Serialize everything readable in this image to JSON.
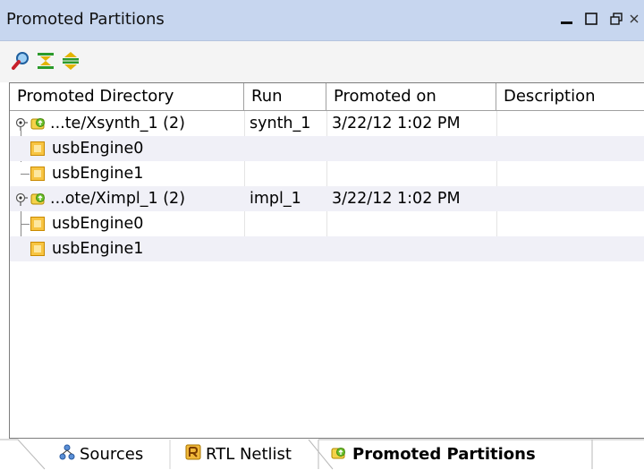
{
  "panel": {
    "title": "Promoted Partitions",
    "window_buttons": [
      "minimize-icon",
      "maximize-icon",
      "restore-icon",
      "close-icon"
    ]
  },
  "toolbar": {
    "buttons": [
      "search-icon",
      "collapse-all-icon",
      "expand-all-icon"
    ]
  },
  "table": {
    "columns": [
      "Promoted Directory",
      "Run",
      "Promoted on",
      "Description"
    ],
    "rows": [
      {
        "label": "...te/Xsynth_1 (2)",
        "run": "synth_1",
        "promoted_on": "3/22/12 1:02 PM",
        "description": "",
        "level": 0,
        "icon": "promoted-dir-icon"
      },
      {
        "label": "usbEngine0",
        "run": "",
        "promoted_on": "",
        "description": "",
        "level": 1,
        "icon": "partition-icon"
      },
      {
        "label": "usbEngine1",
        "run": "",
        "promoted_on": "",
        "description": "",
        "level": 1,
        "icon": "partition-icon"
      },
      {
        "label": "...ote/Ximpl_1 (2)",
        "run": "impl_1",
        "promoted_on": "3/22/12 1:02 PM",
        "description": "",
        "level": 0,
        "icon": "promoted-dir-icon"
      },
      {
        "label": "usbEngine0",
        "run": "",
        "promoted_on": "",
        "description": "",
        "level": 1,
        "icon": "partition-icon"
      },
      {
        "label": "usbEngine1",
        "run": "",
        "promoted_on": "",
        "description": "",
        "level": 1,
        "icon": "partition-icon"
      }
    ]
  },
  "tabs": [
    {
      "label": "Sources",
      "icon": "hierarchy-icon",
      "active": false
    },
    {
      "label": "RTL Netlist",
      "icon": "netlist-icon",
      "active": false
    },
    {
      "label": "Promoted Partitions",
      "icon": "promoted-dir-icon",
      "active": true
    }
  ],
  "colors": {
    "header_bg": "#c7d6ef",
    "alt_row_bg": "#f0f0f7",
    "partition_icon": "#f7c442",
    "promoted_icon": "#6bbf2a"
  }
}
